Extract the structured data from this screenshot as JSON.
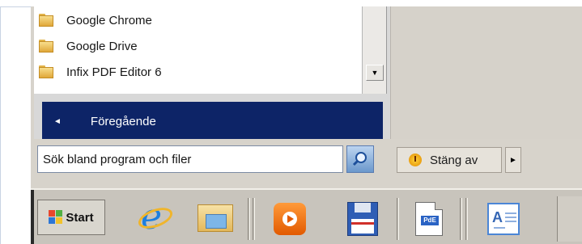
{
  "start_menu": {
    "programs": [
      {
        "label": "Google Chrome",
        "icon": "folder-icon"
      },
      {
        "label": "Google Drive",
        "icon": "folder-icon"
      },
      {
        "label": "Infix PDF Editor 6",
        "icon": "folder-icon"
      }
    ],
    "scroll_down_glyph": "▼",
    "back_arrow_glyph": "◄",
    "back_label": "Föregående",
    "search_placeholder": "Sök bland program och filer",
    "search_icon": "magnifier-icon",
    "shutdown_label": "Stäng av",
    "shutdown_arrow_glyph": "►"
  },
  "taskbar": {
    "start_label": "Start",
    "pinned": [
      {
        "name": "internet-explorer-icon"
      },
      {
        "name": "windows-explorer-icon"
      },
      {
        "name": "media-player-icon"
      },
      {
        "name": "floppy-save-icon"
      },
      {
        "name": "pdf-editor-icon"
      },
      {
        "name": "wordpad-icon"
      }
    ],
    "pdf_badge": "PdE",
    "doc_letter": "A"
  },
  "colors": {
    "nav_bar": "#0d2467",
    "menu_bg": "#d7d3cb",
    "taskbar_bg": "#c8c4bc"
  }
}
